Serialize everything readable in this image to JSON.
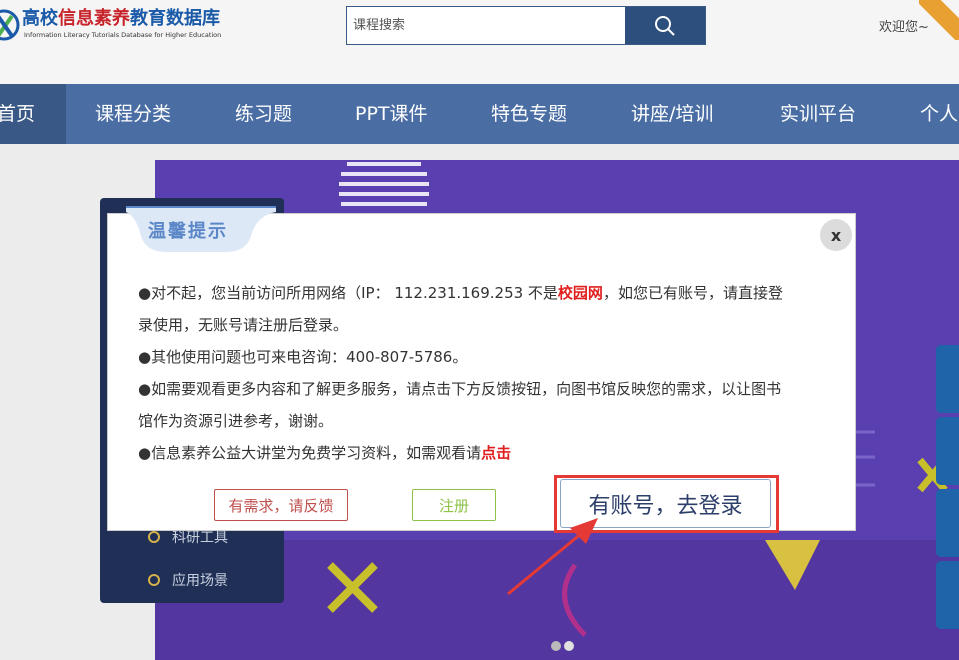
{
  "header": {
    "logo_title_part1": "高校",
    "logo_title_part2": "信息素养",
    "logo_title_part3": "教育数据库",
    "logo_subtitle": "Information Literacy Tutorials Database for Higher Education",
    "search_placeholder": "课程搜索",
    "welcome": "欢迎您~"
  },
  "nav": {
    "items": [
      "首页",
      "课程分类",
      "练习题",
      "PPT课件",
      "特色专题",
      "讲座/培训",
      "实训平台",
      "个人"
    ]
  },
  "sidebar": {
    "items": [
      "科研工具",
      "应用场景"
    ]
  },
  "dialog": {
    "title": "温馨提示",
    "close": "x",
    "line1_a": "●对不起，您当前访问所用网络（IP： 112.231.169.253 不是",
    "line1_red": "校园网",
    "line1_b": "，如您已有账号，请直接登",
    "line2": "录使用，无账号请注册后登录。",
    "line3": "●其他使用问题也可来电咨询：400-807-5786。",
    "line4": "●如需要观看更多内容和了解更多服务，请点击下方反馈按钮，向图书馆反映您的需求，以让图书",
    "line5": "馆作为资源引进参考，谢谢。",
    "line6_a": "●信息素养公益大讲堂为免费学习资料，如需观看请",
    "line6_red": "点击",
    "btn_feedback": "有需求，请反馈",
    "btn_register": "注册",
    "btn_login": "有账号，去登录"
  },
  "colors": {
    "nav_bg": "#4a6ea4",
    "banner_bg": "#5a3fb0",
    "highlight": "#e53935",
    "accent_red": "#e02020"
  }
}
